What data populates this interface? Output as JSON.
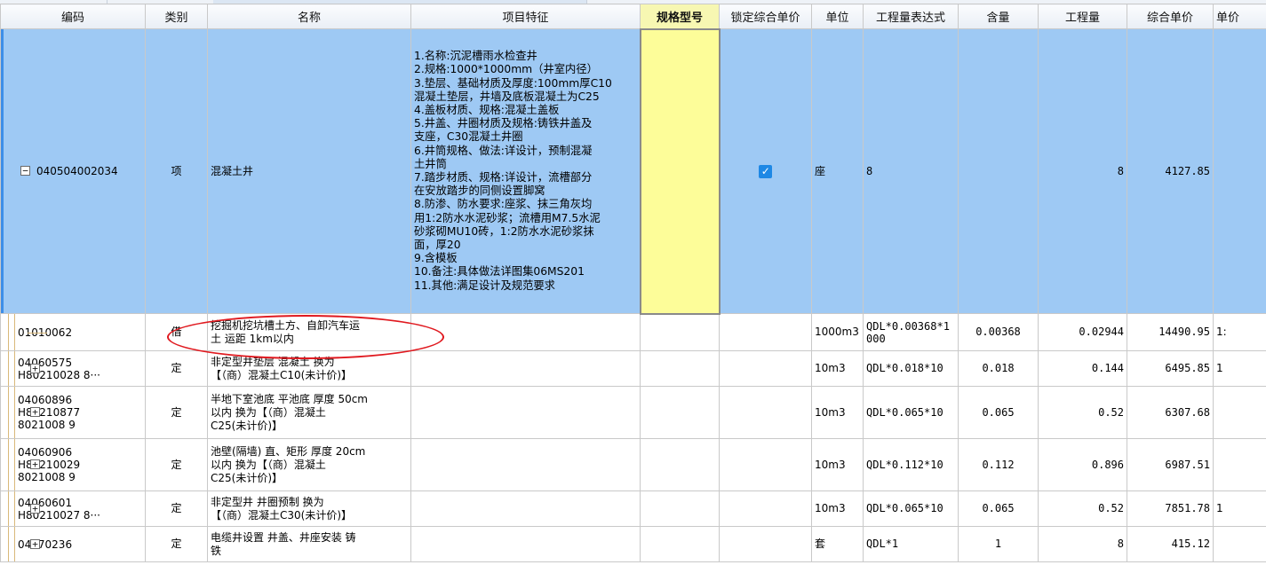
{
  "columns": {
    "code": "编码",
    "category": "类别",
    "name": "名称",
    "features": "项目特征",
    "spec": "规格型号",
    "lock_price": "锁定综合单价",
    "unit": "单位",
    "qty_expr": "工程量表达式",
    "content": "含量",
    "quantity": "工程量",
    "unit_price": "综合单价",
    "last": "单价"
  },
  "main_row": {
    "code": "040504002034",
    "toggle": "−",
    "category": "项",
    "name": "混凝土井",
    "features": "1.名称:沉泥槽雨水检查井\n2.规格:1000*1000mm（井室内径）\n3.垫层、基础材质及厚度:100mm厚C10\n混凝土垫层，井墙及底板混凝土为C25\n4.盖板材质、规格:混凝土盖板\n5.井盖、井圈材质及规格:铸铁井盖及\n支座，C30混凝土井圈\n6.井筒规格、做法:详设计，预制混凝\n土井筒\n7.踏步材质、规格:详设计，流槽部分\n在安放踏步的同侧设置脚窝\n8.防渗、防水要求:座浆、抹三角灰均\n用1:2防水水泥砂浆；流槽用M7.5水泥\n砂浆砌MU10砖，1:2防水水泥砂浆抹\n面，厚20\n9.含模板\n10.备注:具体做法详图集06MS201\n11.其他:满足设计及规范要求",
    "spec": "",
    "lock_checked": "✓",
    "unit": "座",
    "qty_expr": "8",
    "content": "",
    "quantity": "8",
    "unit_price": "4127.85",
    "last": ""
  },
  "sub_rows": [
    {
      "code_lines": "01010062",
      "toggle": "",
      "category": "借",
      "name": "挖掘机挖坑槽土方、自卸汽车运\n土 运距 1km以内",
      "unit": "1000m3",
      "qty_expr": "QDL*0.00368*1\n000",
      "content": "0.00368",
      "quantity": "0.02944",
      "unit_price": "14490.95",
      "last": "1:"
    },
    {
      "code_lines": "04060575\nH80210028 8···",
      "toggle": "+",
      "category": "定",
      "name": "非定型井垫层 混凝土  换为\n【（商）混凝土C10(未计价)】",
      "unit": "10m3",
      "qty_expr": "QDL*0.018*10",
      "content": "0.018",
      "quantity": "0.144",
      "unit_price": "6495.85",
      "last": "1"
    },
    {
      "code_lines": "04060896\nH80210877\n8021008  9",
      "toggle": "+",
      "category": "定",
      "name": "半地下室池底 平池底 厚度 50cm\n以内  换为【（商）混凝土\nC25(未计价)】",
      "unit": "10m3",
      "qty_expr": "QDL*0.065*10",
      "content": "0.065",
      "quantity": "0.52",
      "unit_price": "6307.68",
      "last": ""
    },
    {
      "code_lines": "04060906\nH80210029\n8021008  9",
      "toggle": "+",
      "category": "定",
      "name": "池壁(隔墙) 直、矩形 厚度 20cm\n以内  换为【（商）混凝土\nC25(未计价)】",
      "unit": "10m3",
      "qty_expr": "QDL*0.112*10",
      "content": "0.112",
      "quantity": "0.896",
      "unit_price": "6987.51",
      "last": ""
    },
    {
      "code_lines": "04060601\nH80210027 8···",
      "toggle": "+",
      "category": "定",
      "name": "非定型井 井圈预制  换为\n【（商）混凝土C30(未计价)】",
      "unit": "10m3",
      "qty_expr": "QDL*0.065*10",
      "content": "0.065",
      "quantity": "0.52",
      "unit_price": "7851.78",
      "last": "1"
    },
    {
      "code_lines": "04070236",
      "toggle": "+",
      "category": "定",
      "name": "电缆井设置 井盖、井座安装 铸\n铁",
      "unit": "套",
      "qty_expr": "QDL*1",
      "content": "1",
      "quantity": "8",
      "unit_price": "415.12",
      "last": ""
    }
  ],
  "colors": {
    "selected_row": "#9ec9f4",
    "spec_highlight": "#fdfd99",
    "annotation": "#e0191f",
    "checkbox": "#1e88e5"
  }
}
